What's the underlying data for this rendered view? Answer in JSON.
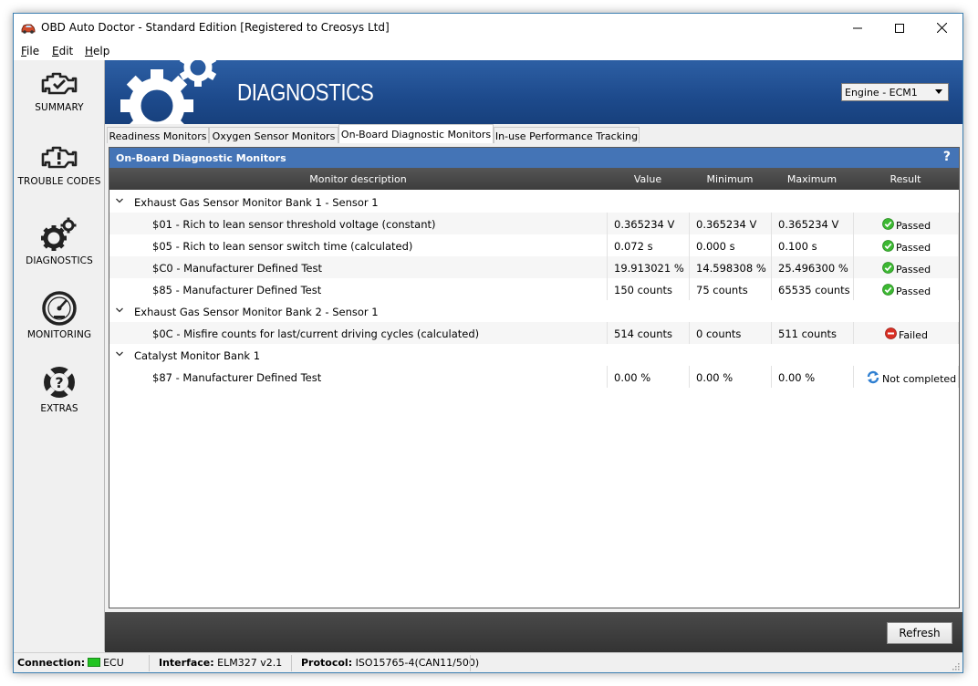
{
  "window": {
    "title": "OBD Auto Doctor - Standard Edition [Registered to Creosys Ltd]"
  },
  "menu": [
    {
      "label": "File",
      "accel": "F",
      "rest": "ile"
    },
    {
      "label": "Edit",
      "accel": "E",
      "rest": "dit"
    },
    {
      "label": "Help",
      "accel": "H",
      "rest": "elp"
    }
  ],
  "nav": [
    {
      "label": "SUMMARY",
      "icon": "engine-check-icon"
    },
    {
      "label": "TROUBLE CODES",
      "icon": "engine-warning-icon"
    },
    {
      "label": "DIAGNOSTICS",
      "icon": "gears-icon"
    },
    {
      "label": "MONITORING",
      "icon": "gauge-icon"
    },
    {
      "label": "EXTRAS",
      "icon": "help-lifebuoy-icon"
    }
  ],
  "banner": {
    "title": "DIAGNOSTICS",
    "ecu_selected": "Engine - ECM1"
  },
  "tabs": [
    {
      "label": "Readiness Monitors",
      "active": false
    },
    {
      "label": "Oxygen Sensor Monitors",
      "active": false
    },
    {
      "label": "On-Board Diagnostic Monitors",
      "active": true
    },
    {
      "label": "In-use Performance Tracking",
      "active": false
    }
  ],
  "panel": {
    "title": "On-Board Diagnostic Monitors",
    "help": "?",
    "columns": {
      "desc": "Monitor description",
      "value": "Value",
      "min": "Minimum",
      "max": "Maximum",
      "result": "Result"
    },
    "groups": [
      {
        "name": "Exhaust Gas Sensor Monitor Bank 1 - Sensor 1",
        "items": [
          {
            "desc": "$01 - Rich to lean sensor threshold voltage (constant)",
            "value": "0.365234 V",
            "min": "0.365234 V",
            "max": "0.365234 V",
            "result": "Passed",
            "status": "passed"
          },
          {
            "desc": "$05 - Rich to lean sensor switch time (calculated)",
            "value": "0.072 s",
            "min": "0.000 s",
            "max": "0.100 s",
            "result": "Passed",
            "status": "passed"
          },
          {
            "desc": "$C0 - Manufacturer Defined Test",
            "value": "19.913021 %",
            "min": "14.598308 %",
            "max": "25.496300 %",
            "result": "Passed",
            "status": "passed"
          },
          {
            "desc": "$85 - Manufacturer Defined Test",
            "value": "150 counts",
            "min": "75 counts",
            "max": "65535 counts",
            "result": "Passed",
            "status": "passed"
          }
        ]
      },
      {
        "name": "Exhaust Gas Sensor Monitor Bank 2 - Sensor 1",
        "items": [
          {
            "desc": "$0C - Misfire counts for last/current driving cycles (calculated)",
            "value": "514 counts",
            "min": "0 counts",
            "max": "511 counts",
            "result": "Failed",
            "status": "failed"
          }
        ]
      },
      {
        "name": "Catalyst Monitor Bank 1",
        "items": [
          {
            "desc": "$87 - Manufacturer Defined Test",
            "value": "0.00 %",
            "min": "0.00 %",
            "max": "0.00 %",
            "result": "Not completed",
            "status": "incomplete"
          }
        ]
      }
    ]
  },
  "actions": {
    "refresh": "Refresh"
  },
  "status": {
    "connection_label": "Connection:",
    "connection_value": "ECU",
    "interface_label": "Interface:",
    "interface_value": "ELM327 v2.1",
    "protocol_label": "Protocol:",
    "protocol_value": "ISO15765-4(CAN11/500)"
  },
  "colors": {
    "accent": "#2d5fa4",
    "panel_header": "#4474b6",
    "passed": "#3cb832",
    "failed": "#d93025",
    "incomplete": "#2f7fd1",
    "connection_led": "#22c422"
  }
}
